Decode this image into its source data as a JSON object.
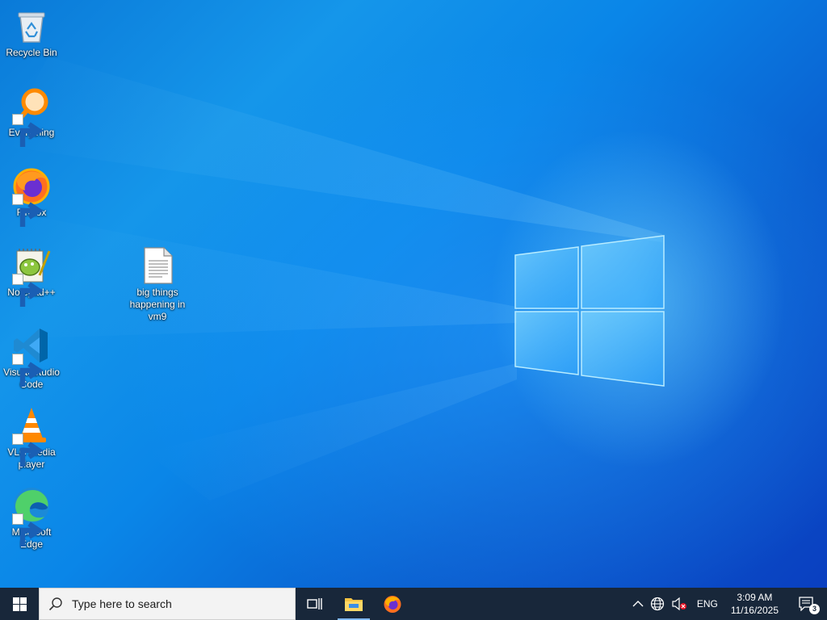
{
  "desktop": {
    "icons": [
      {
        "label": "Recycle Bin",
        "icon": "recycle-bin-icon"
      },
      {
        "label": "Everything",
        "icon": "everything-search-icon"
      },
      {
        "label": "Firefox",
        "icon": "firefox-icon"
      },
      {
        "label": "Notepad++",
        "icon": "notepadpp-icon"
      },
      {
        "label": "big things happening in vm9",
        "icon": "text-file-icon"
      },
      {
        "label": "Visual Studio Code",
        "icon": "vscode-icon"
      },
      {
        "label": "VLC media player",
        "icon": "vlc-icon"
      },
      {
        "label": "Microsoft Edge",
        "icon": "edge-icon"
      }
    ]
  },
  "taskbar": {
    "search_placeholder": "Type here to search",
    "pinned": [
      {
        "name": "task-view",
        "icon": "task-view-icon"
      },
      {
        "name": "file-explorer",
        "icon": "folder-icon",
        "active": true
      },
      {
        "name": "firefox",
        "icon": "firefox-icon"
      }
    ],
    "tray": {
      "language": "ENG",
      "time": "3:09 AM",
      "date": "11/16/2025",
      "notification_count": "3"
    }
  },
  "colors": {
    "taskbar_bg": "#18273a",
    "desktop_accent": "#0a86e8"
  }
}
